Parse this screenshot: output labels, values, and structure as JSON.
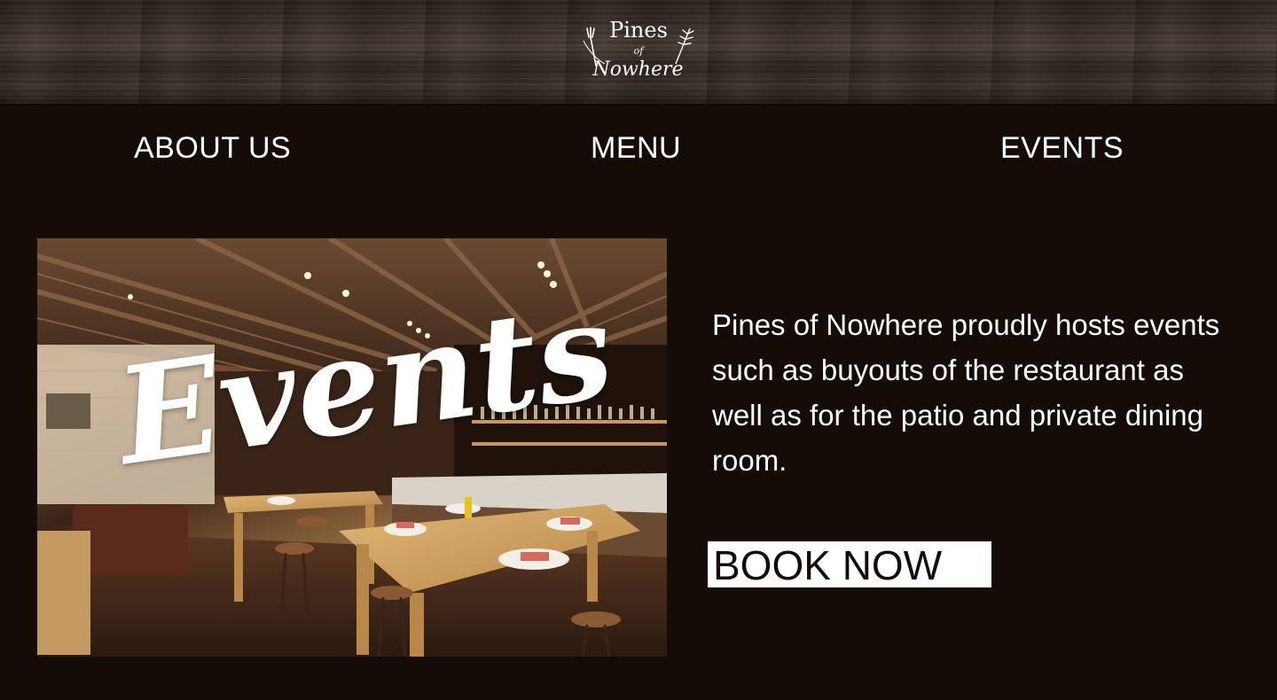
{
  "brand": {
    "line1": "Pines",
    "line2": "of",
    "line3": "Nowhere"
  },
  "nav": {
    "items": [
      {
        "label": "ABOUT US"
      },
      {
        "label": "MENU"
      },
      {
        "label": "EVENTS"
      }
    ]
  },
  "hero": {
    "overlay_title": "Events",
    "photo_icon": "restaurant-interior-photo"
  },
  "content": {
    "description": "Pines of Nowhere proudly hosts events such as buyouts of the restaurant as well as for the patio and private dining room.",
    "book_label": "BOOK NOW"
  },
  "colors": {
    "background": "#150c08",
    "text": "#ffffff",
    "button_bg": "#ffffff",
    "button_text": "#150c08"
  }
}
